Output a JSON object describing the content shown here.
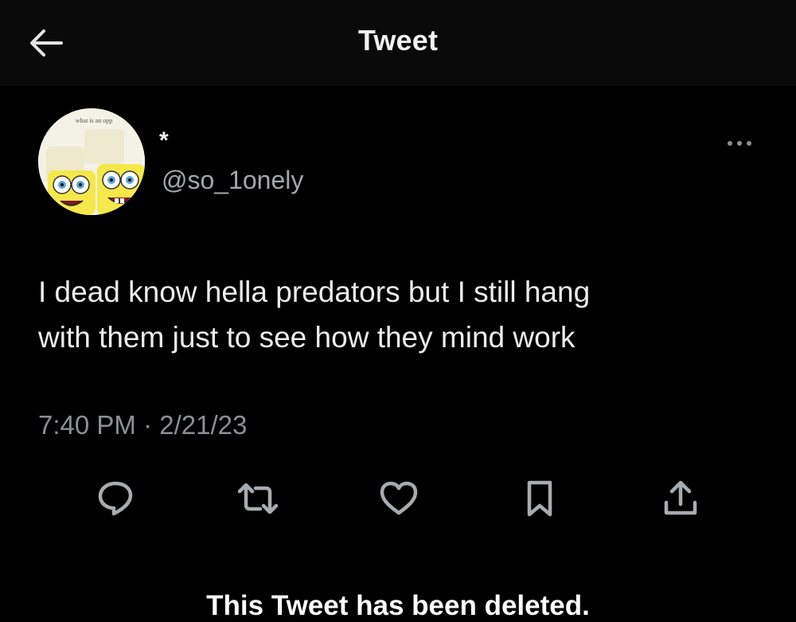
{
  "header": {
    "title": "Tweet",
    "back_icon": "arrow-left-icon"
  },
  "author": {
    "avatar_caption": "what is an opp",
    "display_name": "*",
    "handle": "@so_1onely"
  },
  "tweet": {
    "lines": [
      "I dead know hella predators but I still hang",
      "with them just to see how they mind work"
    ],
    "timestamp": "7:40 PM · 2/21/23"
  },
  "actions": [
    {
      "icon": "reply-icon"
    },
    {
      "icon": "retweet-icon"
    },
    {
      "icon": "like-icon"
    },
    {
      "icon": "bookmark-icon"
    },
    {
      "icon": "share-icon"
    }
  ],
  "banner": {
    "text": "This Tweet has been deleted."
  },
  "colors": {
    "background": "#000000",
    "topbar": "#0a0a0a",
    "text_primary": "#ececec",
    "text_secondary": "#8c9094",
    "icon": "#8b8f93"
  }
}
